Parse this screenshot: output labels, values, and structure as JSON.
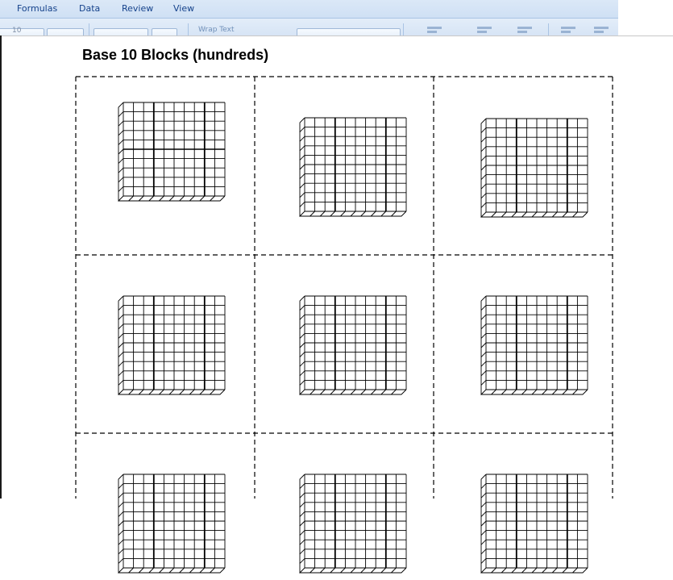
{
  "ribbon": {
    "tabs": [
      {
        "label": "Formulas"
      },
      {
        "label": "Data"
      },
      {
        "label": "Review"
      },
      {
        "label": "View"
      }
    ],
    "font_size_value": "10",
    "wrap_text_label": "Wrap Text"
  },
  "document": {
    "title": "Base 10 Blocks (hundreds)"
  },
  "blocks": {
    "per_row": 3,
    "rows_visible": 3,
    "grid_units": 10
  },
  "colors": {
    "ribbon_text": "#15428b",
    "cut_line": "#000000",
    "block_line": "#000000"
  }
}
